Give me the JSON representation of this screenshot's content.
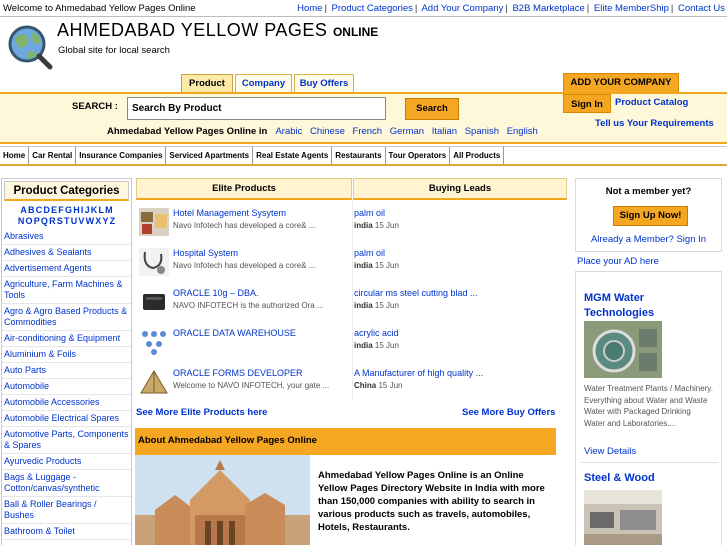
{
  "topbar": {
    "welcome": "Welcome to Ahmedabad Yellow Pages Online",
    "nav": [
      "Home",
      "Product Categories",
      "Add Your Company",
      "B2B Marketplace",
      "Elite MemberShip",
      "Contact Us"
    ]
  },
  "header": {
    "title": "AHMEDABAD YELLOW PAGES",
    "title_suffix": "ONLINE",
    "subtitle": "Global site for local search"
  },
  "tabs": [
    {
      "label": "Product",
      "active": true
    },
    {
      "label": "Company",
      "active": false
    },
    {
      "label": "Buy Offers",
      "active": false
    }
  ],
  "add_company": "ADD YOUR COMPANY",
  "search": {
    "label": "SEARCH :",
    "value": "Search By Product",
    "button": "Search",
    "lang_prefix": "Ahmedabad Yellow Pages Online in",
    "languages": [
      "Arabic",
      "Chinese",
      "French",
      "German",
      "Italian",
      "Spanish",
      "English"
    ]
  },
  "account": {
    "sign_in": "Sign In",
    "product_catalog": "Product Catalog",
    "tell_us": "Tell us Your Requirements"
  },
  "catbar": [
    "Home",
    "Car Rental",
    "Insurance Companies",
    "Serviced Apartments",
    "Real Estate Agents",
    "Restaurants",
    "Tour Operators",
    "All Products"
  ],
  "sidebar": {
    "title": "Product Categories",
    "alpha_row1": [
      "A",
      "B",
      "C",
      "D",
      "E",
      "F",
      "G",
      "H",
      "I",
      "J",
      "K",
      "L",
      "M"
    ],
    "alpha_row2": [
      "N",
      "O",
      "P",
      "Q",
      "R",
      "S",
      "T",
      "U",
      "V",
      "W",
      "X",
      "Y",
      "Z"
    ],
    "categories": [
      "Abrasives",
      "Adhesives & Sealants",
      "Advertisement Agents",
      "Agriculture, Farm Machines & Tools",
      "Agro & Agro Based Products & Commodities",
      "Air-conditioning & Equipment",
      "Aluminium & Foils",
      "Auto Parts",
      "Automobile",
      "Automobile Accessories",
      "Automobile Electrical Spares",
      "Automotive Parts, Components & Spares",
      "Ayurvedic Products",
      "Bags & Luggage - Cotton/canvas/synthetic",
      "Ball & Roller Bearings / Bushes",
      "Bathroom & Toilet"
    ]
  },
  "elite": {
    "heading": "Elite Products",
    "items": [
      {
        "title": "Hotel Management Sysytem",
        "desc": "Navo Infotech has developed a core& ..."
      },
      {
        "title": "Hospital System",
        "desc": "Navo Infotech has developed a core& ..."
      },
      {
        "title": "ORACLE 10g – DBA.",
        "desc": "NAVO INFOTECH is the authorized Ora ..."
      },
      {
        "title": "ORACLE DATA WAREHOUSE",
        "desc": ""
      },
      {
        "title": "ORACLE FORMS DEVELOPER",
        "desc": "Welcome to NAVO INFOTECH, your gate ..."
      }
    ],
    "see_more": "See More Elite Products here"
  },
  "leads": {
    "heading": "Buying Leads",
    "items": [
      {
        "title": "palm oil",
        "country": "india",
        "date": "15 Jun"
      },
      {
        "title": "palm oil",
        "country": "india",
        "date": "15 Jun"
      },
      {
        "title": "circular ms steel cutting blad ...",
        "country": "india",
        "date": "15 Jun"
      },
      {
        "title": "acrylic acid",
        "country": "india",
        "date": "15 Jun"
      },
      {
        "title": "A Manufacturer of high quality ...",
        "country": "China",
        "date": "15 Jun"
      }
    ],
    "see_more": "See More Buy Offers"
  },
  "about": {
    "heading": "About Ahmedabad Yellow Pages Online",
    "text": "Ahmedabad Yellow Pages Online is an Online Yellow Pages Directory Website in India with more than 150,000 companies with ability to search in various products such as travels, automobiles, Hotels, Restaurants."
  },
  "member": {
    "question": "Not a member yet?",
    "signup": "Sign Up Now!",
    "already": "Already a Member? Sign In"
  },
  "ads": {
    "place": "Place your AD here",
    "ad1_title": "MGM Water Technologies",
    "ad1_desc": "Water Treatment Plants / Machinery. Everything about Water and Waste Water with Packaged Drinking Water and Laboratories....",
    "ad1_link": "View Details",
    "ad2_title": "Steel & Wood"
  },
  "colors": {
    "accent_orange": "#f5a623",
    "link_blue": "#0033cc",
    "band_bg": "#fff7d9"
  }
}
